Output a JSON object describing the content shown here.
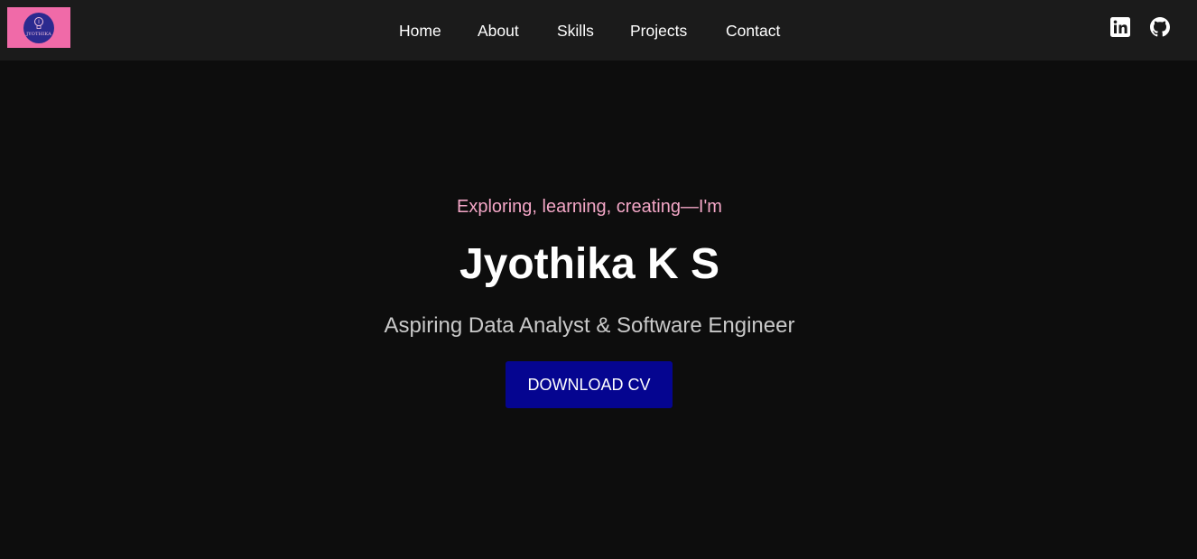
{
  "header": {
    "logo": {
      "text": "JYOTHIKA",
      "icon": "lightbulb-icon",
      "background_color": "#f06aa8",
      "circle_color": "#2b2a8f"
    },
    "nav": [
      {
        "label": "Home"
      },
      {
        "label": "About"
      },
      {
        "label": "Skills"
      },
      {
        "label": "Projects"
      },
      {
        "label": "Contact"
      }
    ],
    "social": [
      {
        "icon": "linkedin-icon"
      },
      {
        "icon": "github-icon"
      }
    ],
    "background_color": "#1b1b1b"
  },
  "hero": {
    "tagline": "Exploring, learning, creating—I'm",
    "name": "Jyothika K S",
    "role": "Aspiring Data Analyst & Software Engineer",
    "cv_button_label": "DOWNLOAD CV",
    "tagline_color": "#f3a6c6",
    "button_color": "#050590",
    "background_color": "#0d0d0d"
  }
}
